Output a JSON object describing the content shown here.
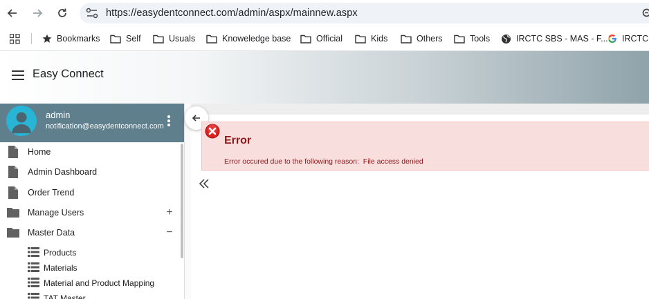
{
  "browser": {
    "url": "https://easydentconnect.com/admin/aspx/mainnew.aspx",
    "nav_icons": [
      "back-arrow-icon",
      "forward-arrow-icon",
      "reload-icon"
    ],
    "bookmarks": [
      {
        "label": "Bookmarks",
        "icon": "star-icon"
      },
      {
        "label": "Self",
        "icon": "folder-icon"
      },
      {
        "label": "Usuals",
        "icon": "folder-icon"
      },
      {
        "label": "Knoweledge base",
        "icon": "folder-icon"
      },
      {
        "label": "Official",
        "icon": "folder-icon"
      },
      {
        "label": "Kids",
        "icon": "folder-icon"
      },
      {
        "label": "Others",
        "icon": "folder-icon"
      },
      {
        "label": "Tools",
        "icon": "folder-icon"
      },
      {
        "label": "IRCTC SBS - MAS - F...",
        "icon": "globe-icon"
      },
      {
        "label": "IRCTC N",
        "icon": "google-icon"
      }
    ]
  },
  "app": {
    "title": "Easy Connect"
  },
  "profile": {
    "name": "admin",
    "email": "notification@easydentconnect.com"
  },
  "menu": [
    {
      "label": "Home",
      "icon": "file-icon",
      "toggle": ""
    },
    {
      "label": "Admin Dashboard",
      "icon": "file-icon",
      "toggle": ""
    },
    {
      "label": "Order Trend",
      "icon": "file-icon",
      "toggle": ""
    },
    {
      "label": "Manage Users",
      "icon": "folder-icon",
      "toggle": "+"
    },
    {
      "label": "Master Data",
      "icon": "folder-icon",
      "toggle": "−"
    }
  ],
  "submenu": [
    {
      "label": "Products",
      "icon": "list-icon"
    },
    {
      "label": "Materials",
      "icon": "list-icon"
    },
    {
      "label": "Material and Product Mapping",
      "icon": "list-icon"
    },
    {
      "label": "TAT Master",
      "icon": "list-icon"
    }
  ],
  "error": {
    "title": "Error",
    "message": "Error occured due to the following reason:  File access denied"
  },
  "colors": {
    "profile_bg": "#5f7f8d",
    "avatar_bg": "#28b4d4",
    "error_bg": "#f9dede",
    "error_text": "#8b1a1a"
  }
}
